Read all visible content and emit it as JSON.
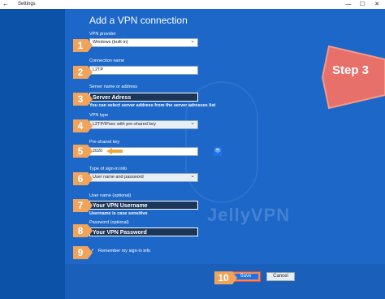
{
  "window": {
    "title": "Settings",
    "back_glyph": "←",
    "min_glyph": "—",
    "max_glyph": "☐",
    "close_glyph": "✕"
  },
  "dialog": {
    "heading": "Add a VPN connection",
    "vpn_provider": {
      "label": "VPN provider",
      "value": "Windows (built-in)"
    },
    "connection_name": {
      "label": "Connection name",
      "value": "L2TP"
    },
    "server": {
      "label": "Server name or address",
      "value": "Server Adress",
      "hint": "You can select server address from the server adresses list"
    },
    "vpn_type": {
      "label": "VPN type",
      "value": "L2TP/IPsec with pre-shared key"
    },
    "psk": {
      "label": "Pre-shared key",
      "value": "2020",
      "eye_glyph": "👁"
    },
    "signin_type": {
      "label": "Type of sign-in info",
      "value": "User name and password"
    },
    "username": {
      "label": "User name (optional)",
      "value": "Your VPN Username",
      "hint": "Username is case sensitive"
    },
    "password": {
      "label": "Password (optional)",
      "value": "Your VPN Password"
    },
    "remember": {
      "label": "Remember my sign-in info",
      "checked_glyph": "✓"
    },
    "save_label": "Save",
    "cancel_label": "Cancel"
  },
  "markers": [
    "1",
    "2",
    "3",
    "4",
    "5",
    "6",
    "7",
    "8",
    "9",
    "10"
  ],
  "badge": {
    "text": "Step 3"
  },
  "watermark": {
    "text": "JellyVPN"
  },
  "colors": {
    "background": "#1f65c0",
    "marker": "#f0a35a",
    "arrow": "#f2a93b",
    "badge": "#e8706a",
    "save_button": "#1a73e8"
  },
  "icons": {
    "back": "arrow-left-icon",
    "dropdown": "chevron-down-icon",
    "reveal": "eye-icon",
    "check": "checkmark-icon"
  }
}
